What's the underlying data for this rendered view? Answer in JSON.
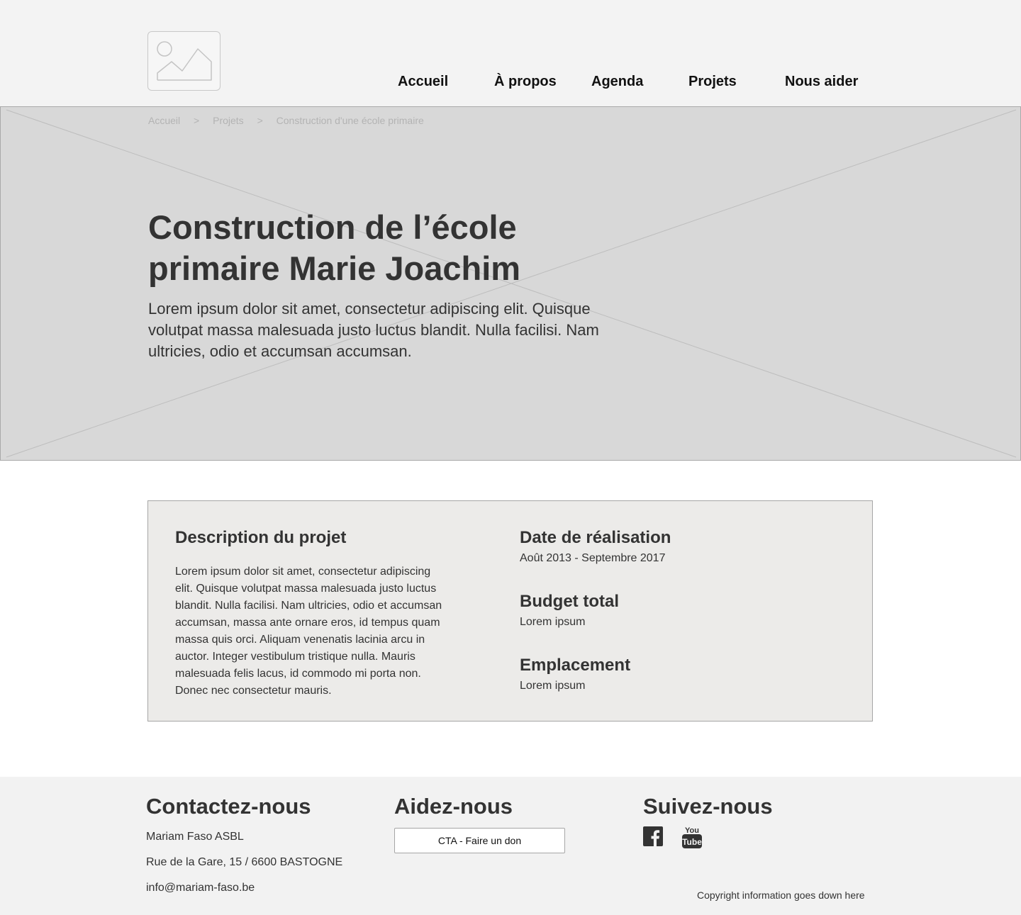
{
  "logo": {
    "icon": "image-placeholder-icon"
  },
  "nav": {
    "items": [
      "Accueil",
      "À propos",
      "Agenda",
      "Projets",
      "Nous aider"
    ]
  },
  "breadcrumb": {
    "items": [
      "Accueil",
      "Projets",
      "Construction d'une école primaire"
    ],
    "separator": ">"
  },
  "hero": {
    "title": "Construction de l’école primaire Marie Joachim",
    "lead": "Lorem ipsum dolor sit amet, consectetur adipiscing elit. Quisque volutpat massa malesuada justo luctus blandit. Nulla facilisi. Nam ultricies, odio et accumsan accumsan."
  },
  "project": {
    "description_title": "Description du projet",
    "description_body": "Lorem ipsum dolor sit amet, consectetur adipiscing elit. Quisque volutpat massa malesuada justo luctus blandit. Nulla facilisi. Nam ultricies, odio et accumsan accumsan, massa ante ornare eros, id tempus quam massa quis orci. Aliquam venenatis lacinia arcu in auctor. Integer vestibulum tristique nulla. Mauris malesuada felis lacus, id commodo mi porta non. Donec nec consectetur mauris.",
    "date_title": "Date de réalisation",
    "date_value": "Août 2013 - Septembre 2017",
    "budget_title": "Budget total",
    "budget_value": "Lorem ipsum",
    "location_title": "Emplacement",
    "location_value": "Lorem ipsum"
  },
  "footer": {
    "contact_title": "Contactez-nous",
    "contact_name": "Mariam Faso ASBL",
    "contact_address": "Rue de la Gare, 15 / 6600 BASTOGNE",
    "contact_email": "info@mariam-faso.be",
    "help_title": "Aidez-nous",
    "cta_label": "CTA - Faire un don",
    "follow_title": "Suivez-nous",
    "social_icons": [
      "facebook-icon",
      "youtube-icon"
    ],
    "youtube_text_top": "You",
    "youtube_text_bottom": "Tube",
    "copyright": "Copyright information goes down here"
  },
  "colors": {
    "header_bg": "#f3f3f3",
    "hero_bg": "#d8d8d8",
    "info_bg": "#ecebe9",
    "footer_bg": "#f2f2f2",
    "text": "#333333"
  }
}
